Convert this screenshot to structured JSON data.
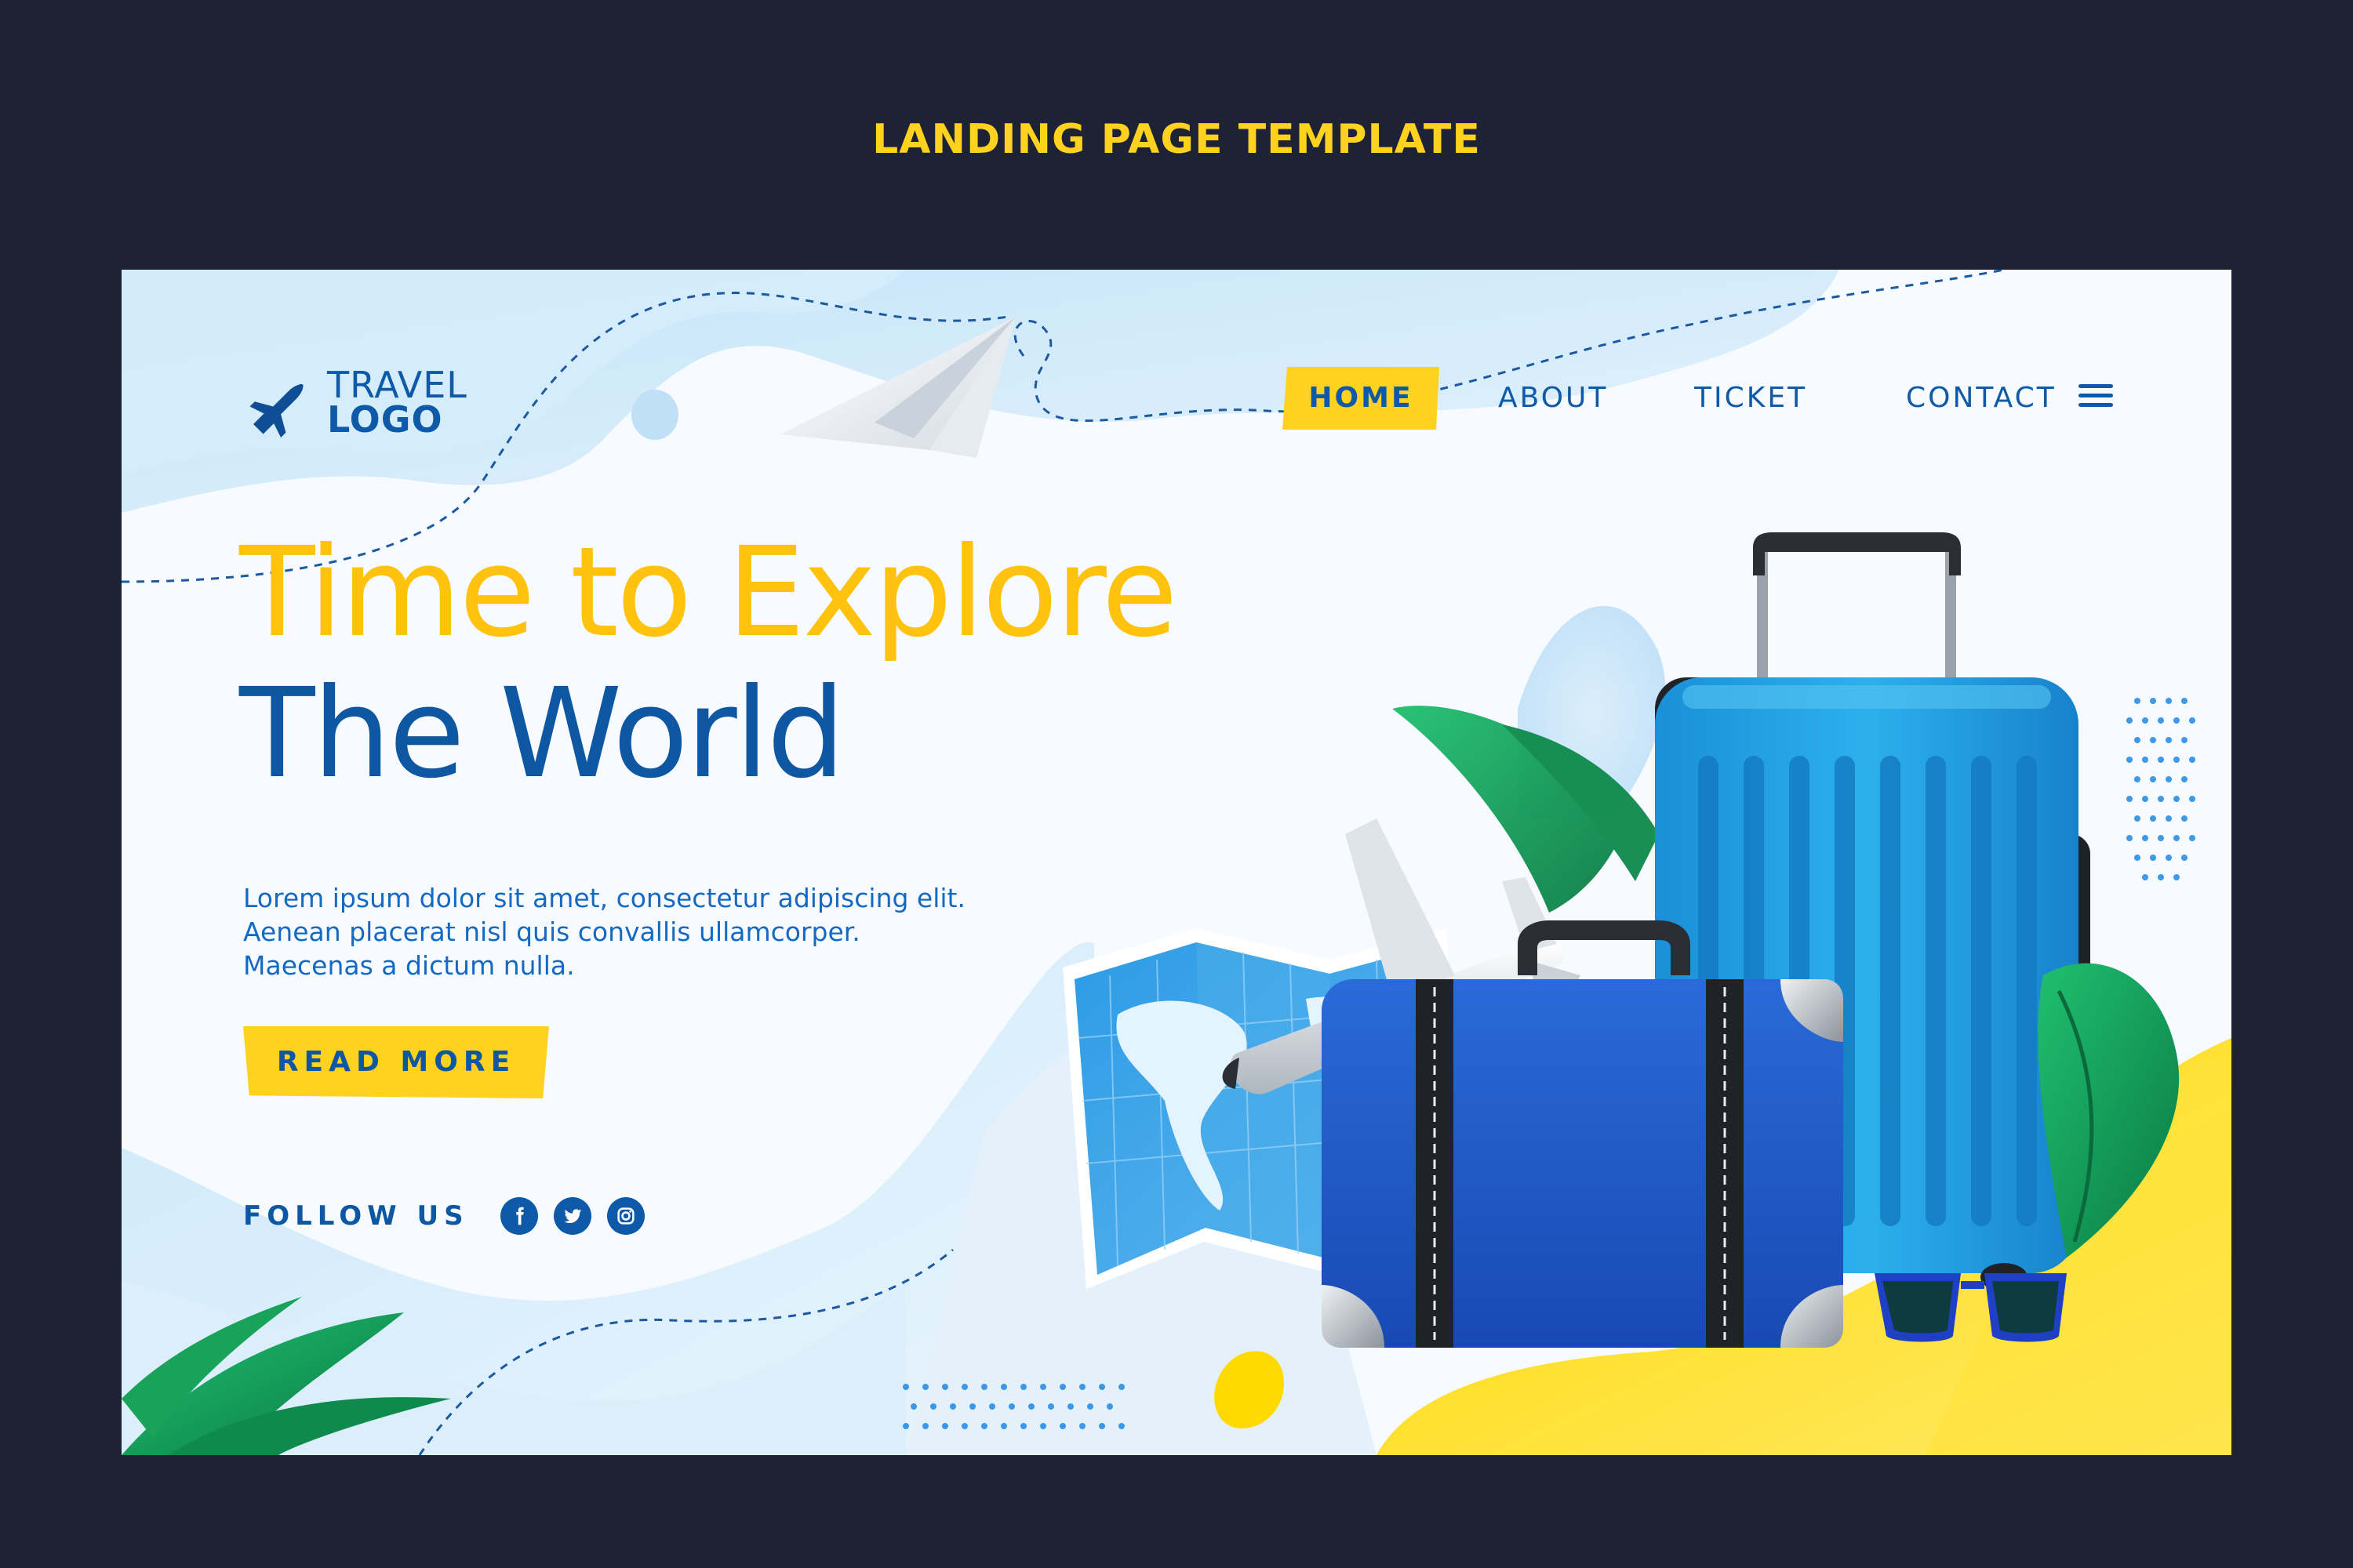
{
  "banner": {
    "title": "LANDING PAGE TEMPLATE"
  },
  "logo": {
    "line1": "TRAVEL",
    "line2": "LOGO"
  },
  "nav": {
    "home": "HOME",
    "about": "ABOUT",
    "ticket": "TICKET",
    "contact": "CONTACT"
  },
  "hero": {
    "title_line1": "Time to Explore",
    "title_line2": "The World",
    "description": [
      "Lorem ipsum dolor sit amet, consectetur adipiscing elit.",
      "Aenean placerat nisl quis convallis ullamcorper.",
      "Maecenas a dictum nulla."
    ],
    "cta": "READ MORE"
  },
  "follow": {
    "label": "FOLLOW US",
    "icons": [
      "facebook-icon",
      "twitter-icon",
      "instagram-icon"
    ]
  },
  "colors": {
    "page_bg": "#1e2235",
    "accent_yellow": "#ffd21f",
    "brand_blue": "#0d57a3",
    "light_blue": "#cfe8f9"
  }
}
